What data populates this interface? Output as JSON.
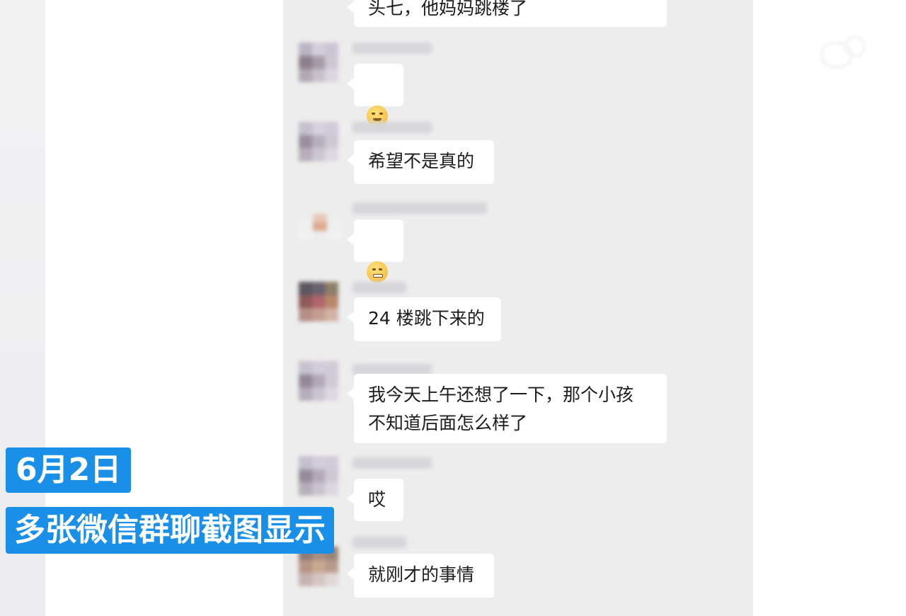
{
  "overlay": {
    "date_label": "6月2日",
    "caption": "多张微信群聊截图显示"
  },
  "colors": {
    "overlay_bg": "#1a8fe8",
    "chat_bg": "#ededed",
    "bubble_bg": "#ffffff"
  },
  "messages": [
    {
      "text": "头七，他妈妈跳楼了"
    },
    {
      "emoji": "grin-emoji"
    },
    {
      "text": "希望不是真的"
    },
    {
      "emoji": "grimace-emoji"
    },
    {
      "text": "24 楼跳下来的"
    },
    {
      "text": "我今天上午还想了一下，那个小孩\n不知道后面怎么样了"
    },
    {
      "text": "哎"
    },
    {
      "text": "就刚才的事情"
    }
  ]
}
